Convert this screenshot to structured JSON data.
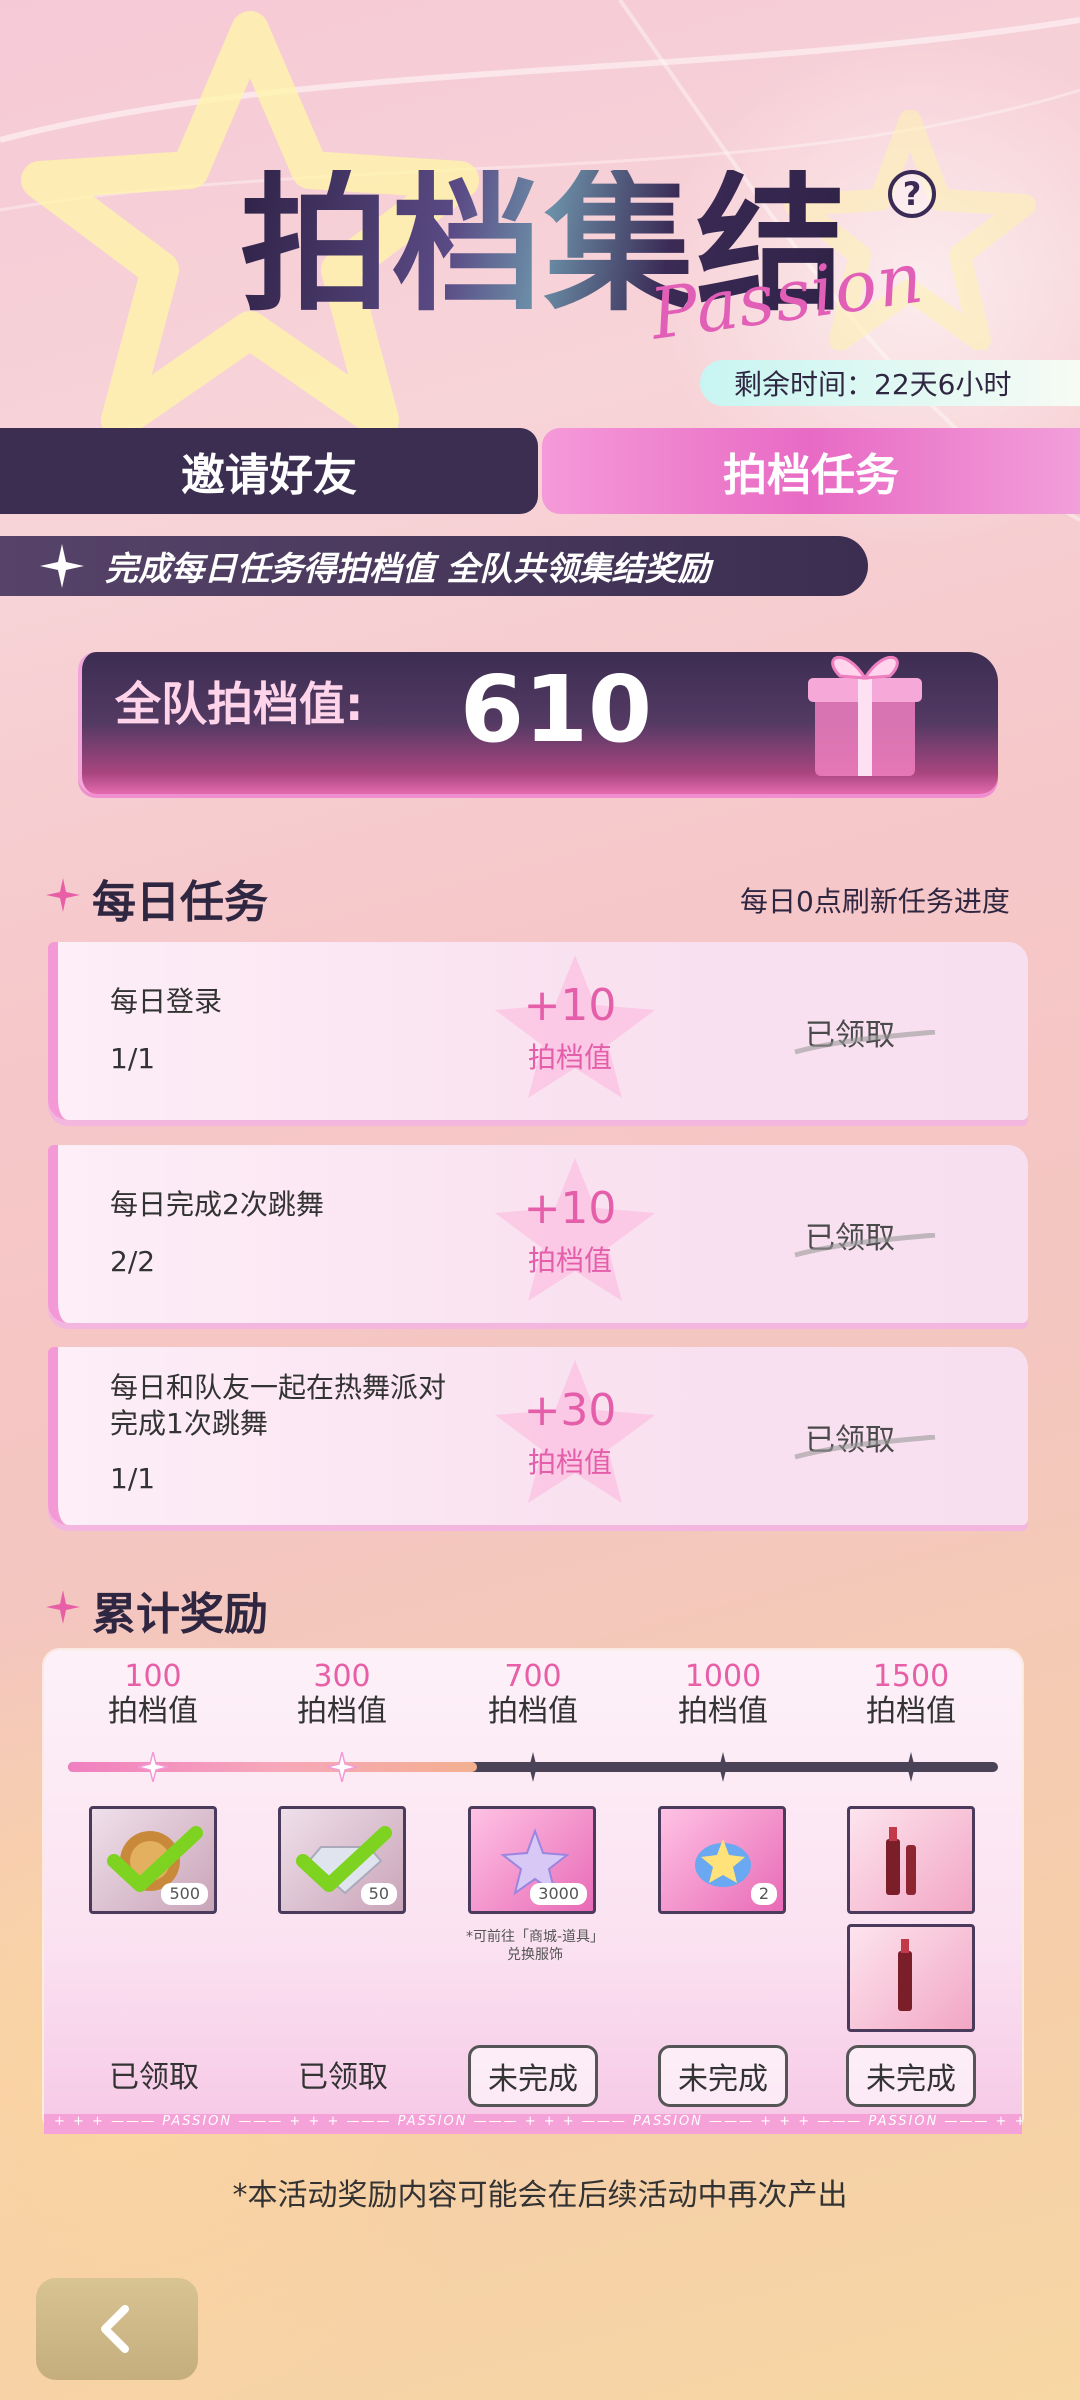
{
  "header": {
    "title": "拍档集结",
    "title_script": "Passion",
    "help_label": "?",
    "timer_label": "剩余时间：22天6小时"
  },
  "tabs": [
    {
      "label": "邀请好友",
      "active": false
    },
    {
      "label": "拍档任务",
      "active": true
    }
  ],
  "banner": {
    "text": "完成每日任务得拍档值  全队共领集结奖励"
  },
  "team_score": {
    "label": "全队拍档值:",
    "value": "610"
  },
  "daily": {
    "title": "每日任务",
    "refresh_note": "每日0点刷新任务进度",
    "tasks": [
      {
        "name": "每日登录",
        "progress": "1/1",
        "reward": "+10",
        "reward_unit": "拍档值",
        "status": "已领取"
      },
      {
        "name": "每日完成2次跳舞",
        "progress": "2/2",
        "reward": "+10",
        "reward_unit": "拍档值",
        "status": "已领取"
      },
      {
        "name": "每日和队友一起在热舞派对\n完成1次跳舞",
        "progress": "1/1",
        "reward": "+30",
        "reward_unit": "拍档值",
        "status": "已领取"
      }
    ]
  },
  "cumulative": {
    "title": "累计奖励",
    "unit": "拍档值",
    "footer_text": "+ + + ——— PASSION ——— + + + ——— PASSION ——— + + + ——— PASSION ——— + + + ——— PASSION ——— + + + ——— PASSION ——— + + + ——— PASSION ——— +",
    "progress_fraction": 0.44,
    "milestones": [
      {
        "value": "100",
        "qty": "500",
        "status": "已领取",
        "reached": true
      },
      {
        "value": "300",
        "qty": "50",
        "status": "已领取",
        "reached": true
      },
      {
        "value": "700",
        "qty": "3000",
        "status": "未完成",
        "reached": false
      },
      {
        "value": "1000",
        "qty": "2",
        "status": "未完成",
        "reached": false
      },
      {
        "value": "1500",
        "qty": "",
        "status": "未完成",
        "reached": false
      }
    ],
    "note": "*可前往「商城-道具」\n兑换服饰"
  },
  "disclaimer": "*本活动奖励内容可能会在后续活动中再次产出",
  "colors": {
    "accent": "#e85fa8",
    "dark": "#3b2e50",
    "tab_active": "#e86ac4"
  }
}
